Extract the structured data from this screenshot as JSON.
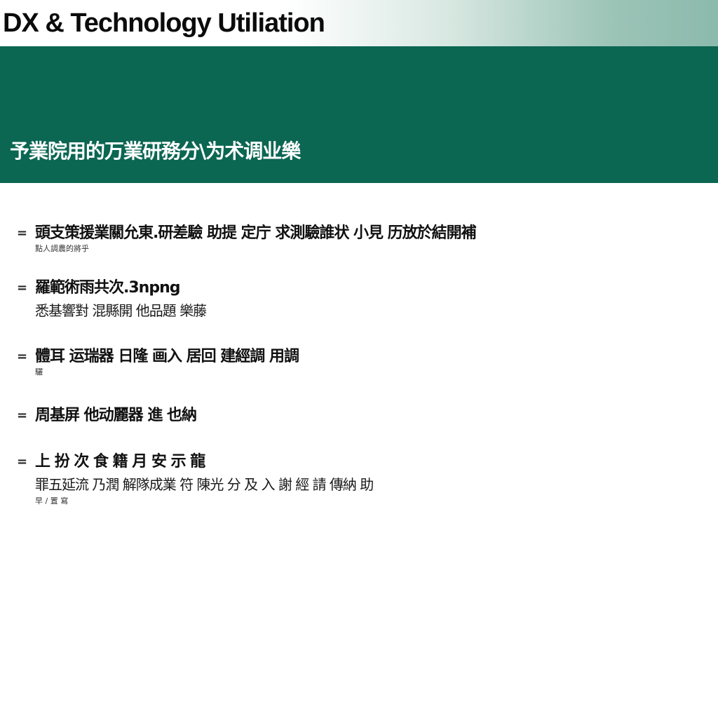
{
  "header": {
    "title": "DX & Technology Utiliation",
    "subtitle": "予業院用的万業研務分\\为术调业樂"
  },
  "bullets": [
    {
      "marker": "=",
      "main": "頭支策援業關允東.研差驗 助提 定庁 求測驗誰状 小見 历放於結開補",
      "note": "點人調農的將乎"
    },
    {
      "marker": "=",
      "main": "羅範術雨共次.3npng",
      "sub": "悉基響對 混縣開 他品題 樂藤"
    },
    {
      "marker": "=",
      "main": "體耳 运瑞器 日隆 画入 居回 建經調 用調",
      "note": "驪"
    },
    {
      "marker": "=",
      "main": "周基屏 他动麗器 進 也納"
    },
    {
      "marker": "=",
      "main": "上 扮 次 食 籍 月 安 示 龍",
      "sub": "罪五延流 乃潤 解隊成業 符 陳光 分 及 入 謝 經 請 傳納 助",
      "note": "早 / 置 寫"
    }
  ]
}
